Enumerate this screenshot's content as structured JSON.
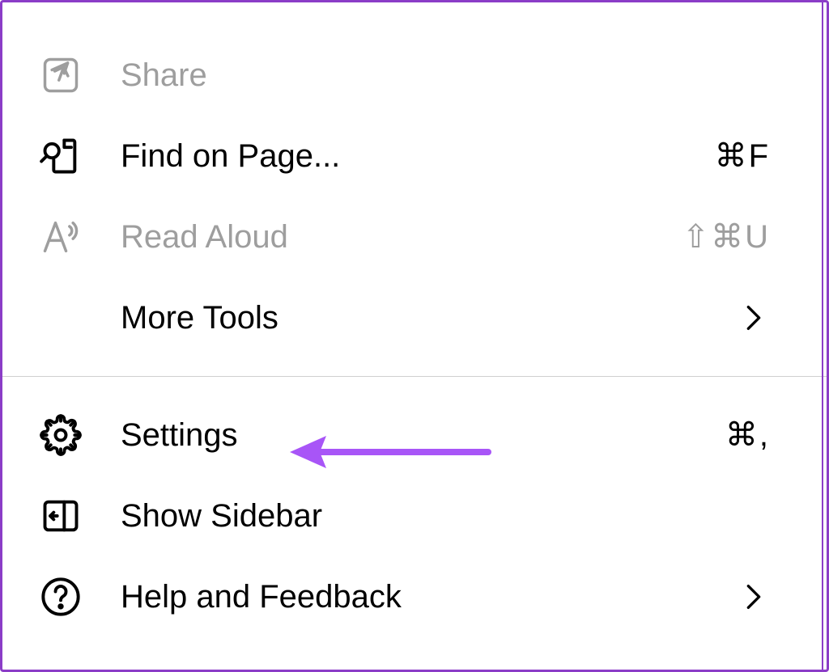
{
  "menu": {
    "share": {
      "label": "Share",
      "enabled": false
    },
    "find_on_page": {
      "label": "Find on Page...",
      "shortcut": "⌘F",
      "enabled": true
    },
    "read_aloud": {
      "label": "Read Aloud",
      "shortcut": "⇧⌘U",
      "enabled": false
    },
    "more_tools": {
      "label": "More Tools",
      "enabled": true,
      "has_submenu": true
    },
    "settings": {
      "label": "Settings",
      "shortcut": "⌘,",
      "enabled": true
    },
    "show_sidebar": {
      "label": "Show Sidebar",
      "enabled": true
    },
    "help_and_feedback": {
      "label": "Help and Feedback",
      "enabled": true,
      "has_submenu": true
    }
  },
  "annotation": {
    "color": "#a855f7"
  }
}
